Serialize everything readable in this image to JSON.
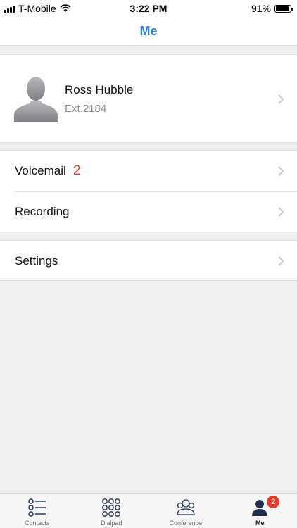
{
  "status_bar": {
    "carrier": "T-Mobile",
    "time": "3:22 PM",
    "battery_percent": "91%",
    "battery_level": 0.91
  },
  "header": {
    "title": "Me"
  },
  "profile": {
    "name": "Ross Hubble",
    "extension": "Ext.2184"
  },
  "menu": {
    "voicemail_label": "Voicemail",
    "voicemail_count": "2",
    "recording_label": "Recording",
    "settings_label": "Settings"
  },
  "tabs": [
    {
      "label": "Contacts",
      "icon": "contacts-list-icon"
    },
    {
      "label": "Dialpad",
      "icon": "dialpad-icon"
    },
    {
      "label": "Conference",
      "icon": "conference-icon"
    },
    {
      "label": "Me",
      "icon": "person-icon",
      "badge": "2",
      "active": true
    }
  ],
  "colors": {
    "accent": "#2f7bd1",
    "badge": "#e43b2c",
    "tab_icon": "#1f2d4f"
  }
}
